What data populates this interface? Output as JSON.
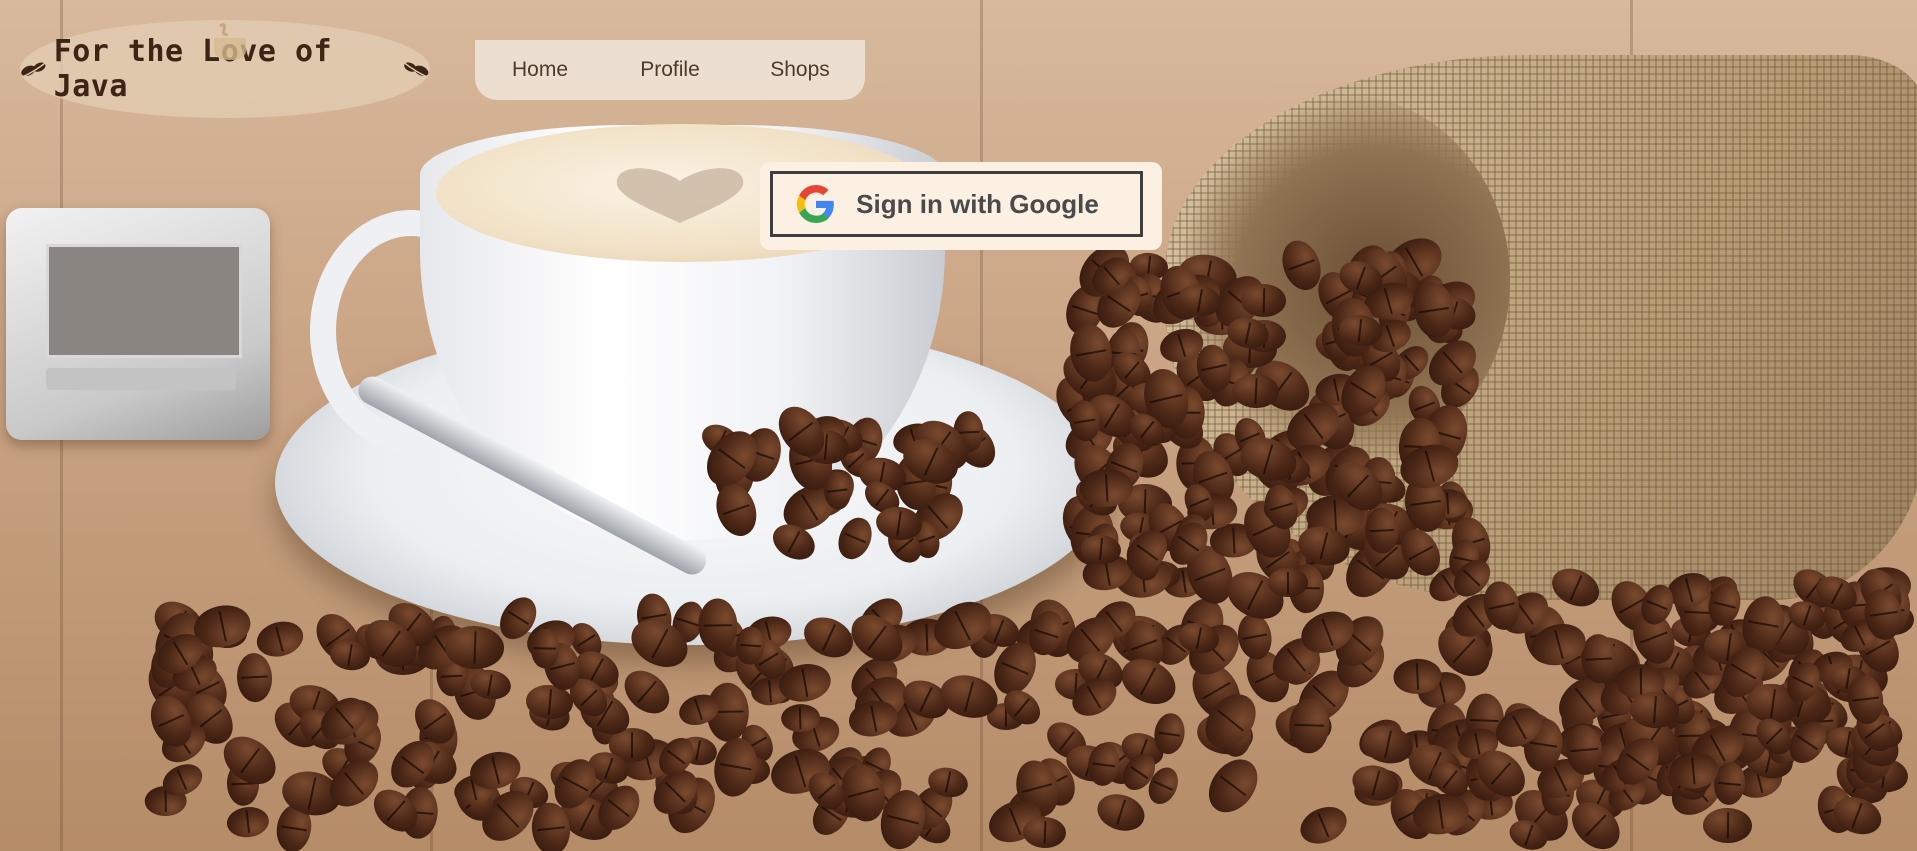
{
  "brand": {
    "title": "For the Love of Java"
  },
  "nav": {
    "items": [
      {
        "label": "Home"
      },
      {
        "label": "Profile"
      },
      {
        "label": "Shops"
      }
    ]
  },
  "auth": {
    "google_button_label": "Sign in with Google"
  },
  "colors": {
    "brand_text": "#3d2516",
    "nav_text": "#4e3a2a",
    "signin_bg": "#fbf0e2",
    "signin_border": "#3e3e3e"
  },
  "icons": [
    "coffee-leaf-icon",
    "coffee-mug-icon",
    "google-g-icon"
  ]
}
